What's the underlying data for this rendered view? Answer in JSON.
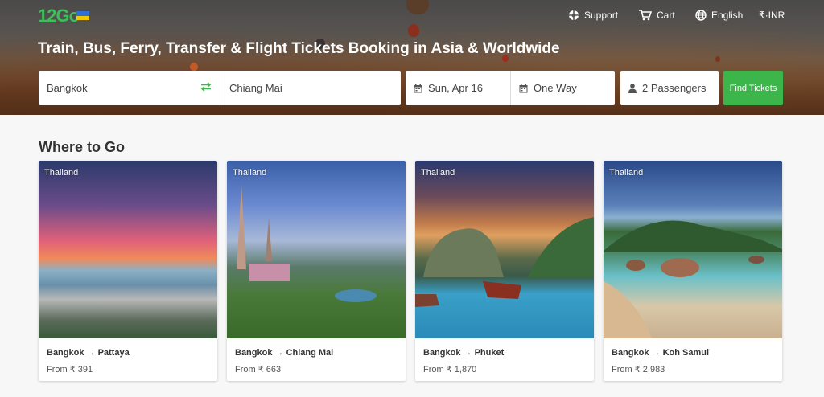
{
  "header": {
    "logo_text": "12Go",
    "nav": {
      "support": "Support",
      "cart": "Cart",
      "language": "English",
      "currency": "₹·INR"
    },
    "headline": "Train, Bus, Ferry, Transfer & Flight Tickets Booking in Asia & Worldwide"
  },
  "search": {
    "from": "Bangkok",
    "to": "Chiang Mai",
    "date": "Sun, Apr 16",
    "trip_type": "One Way",
    "passengers": "2 Passengers",
    "submit_label": "Find Tickets"
  },
  "section": {
    "title": "Where to Go"
  },
  "cards": [
    {
      "country": "Thailand",
      "route": "Bangkok → Pattaya",
      "price": "From ₹ 391"
    },
    {
      "country": "Thailand",
      "route": "Bangkok → Chiang Mai",
      "price": "From ₹ 663"
    },
    {
      "country": "Thailand",
      "route": "Bangkok → Phuket",
      "price": "From ₹ 1,870"
    },
    {
      "country": "Thailand",
      "route": "Bangkok → Koh Samui",
      "price": "From ₹ 2,983"
    }
  ],
  "colors": {
    "accent": "#3cb54a",
    "flag_top": "#2f6fd6",
    "flag_bottom": "#f2c800"
  }
}
